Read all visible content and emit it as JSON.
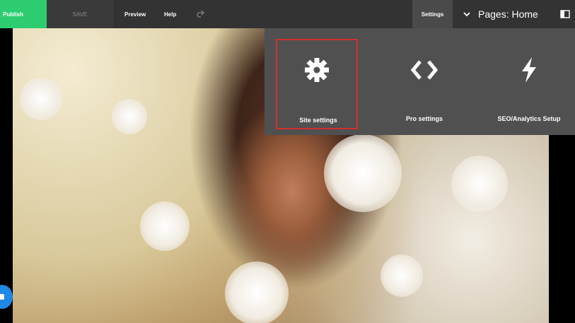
{
  "toolbar": {
    "publish_label": "Publish",
    "save_label": "SAVE",
    "preview_label": "Preview",
    "help_label": "Help",
    "settings_label": "Settings",
    "pages_label": "Pages: Home"
  },
  "settings_menu": {
    "items": [
      {
        "label": "Site settings",
        "icon": "gear-icon"
      },
      {
        "label": "Pro settings",
        "icon": "code-icon"
      },
      {
        "label": "SEO/Analytics Setup",
        "icon": "lightning-icon"
      }
    ],
    "highlight_color": "#d1302f"
  },
  "colors": {
    "publish": "#2ecc71",
    "toolbar": "#333333",
    "panel": "#505050",
    "chat": "#1e88e5"
  }
}
